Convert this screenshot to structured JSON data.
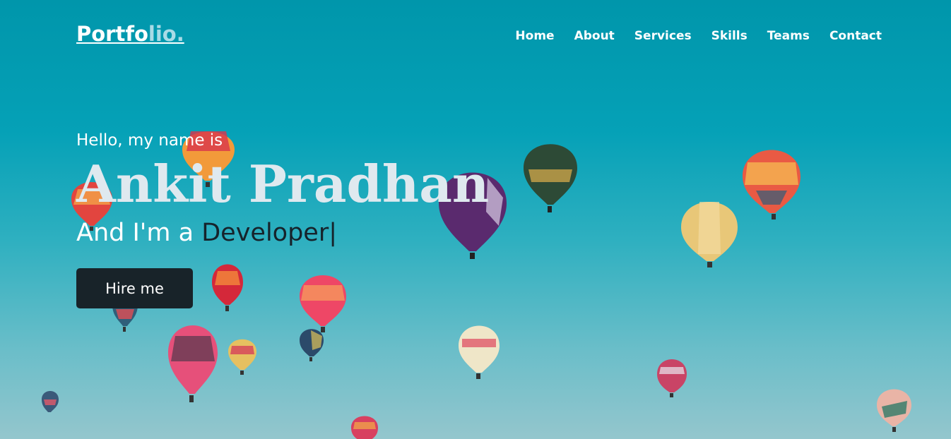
{
  "logo": {
    "text": "Portfo",
    "accent": "lio."
  },
  "nav": {
    "home": "Home",
    "about": "About",
    "services": "Services",
    "skills": "Skills",
    "teams": "Teams",
    "contact": "Contact"
  },
  "hero": {
    "greeting": "Hello, my name is",
    "name": "Ankit Pradhan",
    "role_prefix": "And I'm a ",
    "role": "Developer",
    "cursor": "|",
    "button": "Hire me"
  },
  "colors": {
    "sky_top": "#0096ab",
    "sky_bottom": "#94c6cd",
    "button_bg": "#182329",
    "role_text": "#16232b",
    "logo_accent": "#a9dbe6"
  }
}
